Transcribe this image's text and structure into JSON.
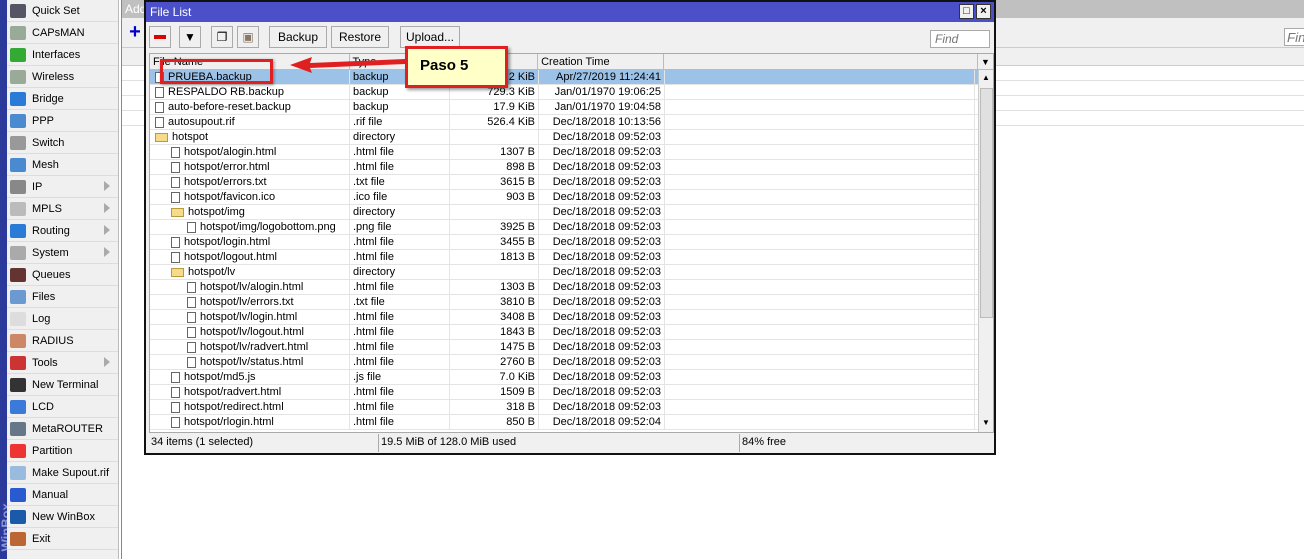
{
  "sidebar": {
    "brand": "WinBox",
    "items": [
      {
        "label": "Quick Set",
        "color": "#556",
        "sub": false
      },
      {
        "label": "CAPsMAN",
        "color": "#9a9",
        "sub": false
      },
      {
        "label": "Interfaces",
        "color": "#3a3",
        "sub": false
      },
      {
        "label": "Wireless",
        "color": "#9a9",
        "sub": false
      },
      {
        "label": "Bridge",
        "color": "#2a7ad8",
        "sub": false
      },
      {
        "label": "PPP",
        "color": "#4a8ad0",
        "sub": false
      },
      {
        "label": "Switch",
        "color": "#999",
        "sub": false
      },
      {
        "label": "Mesh",
        "color": "#4a8ad0",
        "sub": false
      },
      {
        "label": "IP",
        "color": "#888",
        "sub": true
      },
      {
        "label": "MPLS",
        "color": "#bbb",
        "sub": true
      },
      {
        "label": "Routing",
        "color": "#2a7ad8",
        "sub": true
      },
      {
        "label": "System",
        "color": "#aaa",
        "sub": true
      },
      {
        "label": "Queues",
        "color": "#633",
        "sub": false
      },
      {
        "label": "Files",
        "color": "#6a9ad0",
        "sub": false
      },
      {
        "label": "Log",
        "color": "#ddd",
        "sub": false
      },
      {
        "label": "RADIUS",
        "color": "#c86",
        "sub": false
      },
      {
        "label": "Tools",
        "color": "#c33",
        "sub": true
      },
      {
        "label": "New Terminal",
        "color": "#333",
        "sub": false
      },
      {
        "label": "LCD",
        "color": "#3a7ad8",
        "sub": false
      },
      {
        "label": "MetaROUTER",
        "color": "#678",
        "sub": false
      },
      {
        "label": "Partition",
        "color": "#e33",
        "sub": false
      },
      {
        "label": "Make Supout.rif",
        "color": "#9bd",
        "sub": false
      },
      {
        "label": "Manual",
        "color": "#2a5ad0",
        "sub": false
      },
      {
        "label": "New WinBox",
        "color": "#1a5aa8",
        "sub": false
      },
      {
        "label": "Exit",
        "color": "#b63",
        "sub": false
      }
    ]
  },
  "background_window": {
    "title": "Add",
    "add_icon": "plus-icon",
    "find_placeholder": "Find"
  },
  "window": {
    "title": "File List",
    "toolbar": {
      "remove_icon": "minus-icon",
      "filter_icon": "filter-icon",
      "copy_icon": "copy-icon",
      "paste_icon": "paste-icon",
      "backup": "Backup",
      "restore": "Restore",
      "upload": "Upload..."
    },
    "find_placeholder": "Find",
    "columns": {
      "name": "File Name",
      "type": "Type",
      "size": "",
      "time": "Creation Time"
    },
    "rows": [
      {
        "name": "PRUEBA.backup",
        "type": "backup",
        "size": "93.2 KiB",
        "time": "Apr/27/2019 11:24:41",
        "level": 0,
        "kind": "file",
        "selected": true
      },
      {
        "name": "RESPALDO RB.backup",
        "type": "backup",
        "size": "729.3 KiB",
        "time": "Jan/01/1970 19:06:25",
        "level": 0,
        "kind": "file"
      },
      {
        "name": "auto-before-reset.backup",
        "type": "backup",
        "size": "17.9 KiB",
        "time": "Jan/01/1970 19:04:58",
        "level": 0,
        "kind": "file"
      },
      {
        "name": "autosupout.rif",
        "type": ".rif file",
        "size": "526.4 KiB",
        "time": "Dec/18/2018 10:13:56",
        "level": 0,
        "kind": "file"
      },
      {
        "name": "hotspot",
        "type": "directory",
        "size": "",
        "time": "Dec/18/2018 09:52:03",
        "level": 0,
        "kind": "dir"
      },
      {
        "name": "hotspot/alogin.html",
        "type": ".html file",
        "size": "1307 B",
        "time": "Dec/18/2018 09:52:03",
        "level": 1,
        "kind": "file"
      },
      {
        "name": "hotspot/error.html",
        "type": ".html file",
        "size": "898 B",
        "time": "Dec/18/2018 09:52:03",
        "level": 1,
        "kind": "file"
      },
      {
        "name": "hotspot/errors.txt",
        "type": ".txt file",
        "size": "3615 B",
        "time": "Dec/18/2018 09:52:03",
        "level": 1,
        "kind": "file"
      },
      {
        "name": "hotspot/favicon.ico",
        "type": ".ico file",
        "size": "903 B",
        "time": "Dec/18/2018 09:52:03",
        "level": 1,
        "kind": "file"
      },
      {
        "name": "hotspot/img",
        "type": "directory",
        "size": "",
        "time": "Dec/18/2018 09:52:03",
        "level": 1,
        "kind": "dir"
      },
      {
        "name": "hotspot/img/logobottom.png",
        "type": ".png file",
        "size": "3925 B",
        "time": "Dec/18/2018 09:52:03",
        "level": 2,
        "kind": "file"
      },
      {
        "name": "hotspot/login.html",
        "type": ".html file",
        "size": "3455 B",
        "time": "Dec/18/2018 09:52:03",
        "level": 1,
        "kind": "file"
      },
      {
        "name": "hotspot/logout.html",
        "type": ".html file",
        "size": "1813 B",
        "time": "Dec/18/2018 09:52:03",
        "level": 1,
        "kind": "file"
      },
      {
        "name": "hotspot/lv",
        "type": "directory",
        "size": "",
        "time": "Dec/18/2018 09:52:03",
        "level": 1,
        "kind": "dir"
      },
      {
        "name": "hotspot/lv/alogin.html",
        "type": ".html file",
        "size": "1303 B",
        "time": "Dec/18/2018 09:52:03",
        "level": 2,
        "kind": "file"
      },
      {
        "name": "hotspot/lv/errors.txt",
        "type": ".txt file",
        "size": "3810 B",
        "time": "Dec/18/2018 09:52:03",
        "level": 2,
        "kind": "file"
      },
      {
        "name": "hotspot/lv/login.html",
        "type": ".html file",
        "size": "3408 B",
        "time": "Dec/18/2018 09:52:03",
        "level": 2,
        "kind": "file"
      },
      {
        "name": "hotspot/lv/logout.html",
        "type": ".html file",
        "size": "1843 B",
        "time": "Dec/18/2018 09:52:03",
        "level": 2,
        "kind": "file"
      },
      {
        "name": "hotspot/lv/radvert.html",
        "type": ".html file",
        "size": "1475 B",
        "time": "Dec/18/2018 09:52:03",
        "level": 2,
        "kind": "file"
      },
      {
        "name": "hotspot/lv/status.html",
        "type": ".html file",
        "size": "2760 B",
        "time": "Dec/18/2018 09:52:03",
        "level": 2,
        "kind": "file"
      },
      {
        "name": "hotspot/md5.js",
        "type": ".js file",
        "size": "7.0 KiB",
        "time": "Dec/18/2018 09:52:03",
        "level": 1,
        "kind": "file"
      },
      {
        "name": "hotspot/radvert.html",
        "type": ".html file",
        "size": "1509 B",
        "time": "Dec/18/2018 09:52:03",
        "level": 1,
        "kind": "file"
      },
      {
        "name": "hotspot/redirect.html",
        "type": ".html file",
        "size": "318 B",
        "time": "Dec/18/2018 09:52:03",
        "level": 1,
        "kind": "file"
      },
      {
        "name": "hotspot/rlogin.html",
        "type": ".html file",
        "size": "850 B",
        "time": "Dec/18/2018 09:52:04",
        "level": 1,
        "kind": "file"
      }
    ],
    "status": {
      "items": "34 items (1 selected)",
      "used": "19.5 MiB of 128.0 MiB used",
      "free": "84% free"
    }
  },
  "annotation": {
    "callout": "Paso 5",
    "color": "#e02020"
  }
}
